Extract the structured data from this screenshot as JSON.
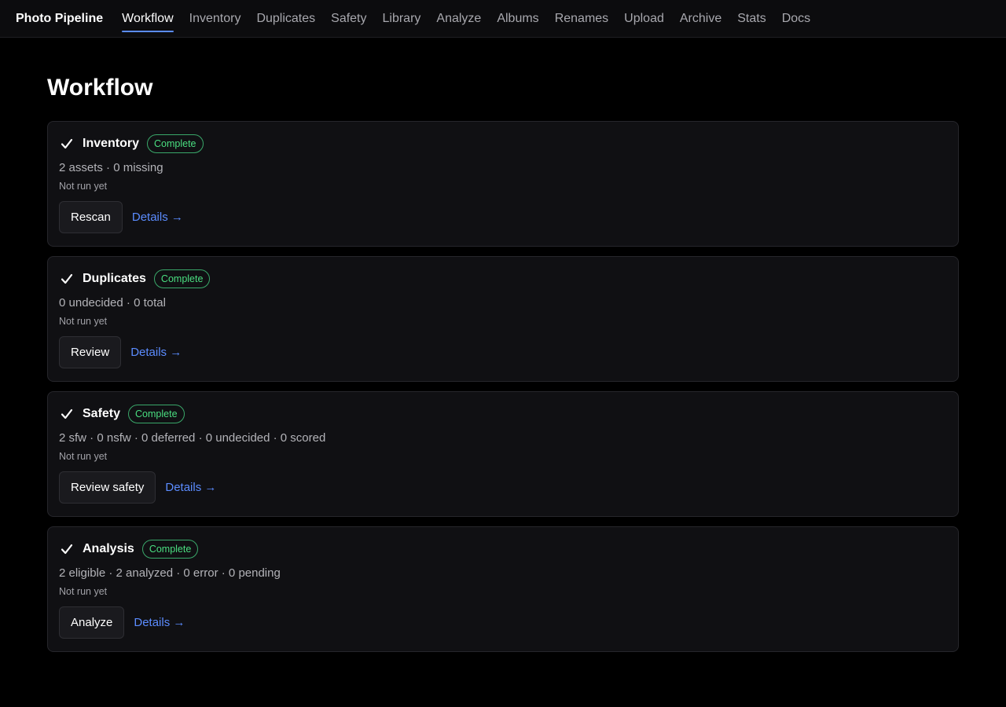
{
  "app": {
    "title": "Photo Pipeline"
  },
  "nav": {
    "items": [
      {
        "label": "Workflow",
        "active": true
      },
      {
        "label": "Inventory"
      },
      {
        "label": "Duplicates"
      },
      {
        "label": "Safety"
      },
      {
        "label": "Library"
      },
      {
        "label": "Analyze"
      },
      {
        "label": "Albums"
      },
      {
        "label": "Renames"
      },
      {
        "label": "Upload"
      },
      {
        "label": "Archive"
      },
      {
        "label": "Stats"
      },
      {
        "label": "Docs"
      }
    ]
  },
  "page": {
    "title": "Workflow"
  },
  "colors": {
    "accent": "#5b8cff",
    "status_complete": "#4ade80",
    "background": "#000000",
    "card": "#101013"
  },
  "steps": [
    {
      "icon": "check-icon",
      "title": "Inventory",
      "status": "Complete",
      "stats": "2 assets · 0 missing",
      "last_run": "Not run yet",
      "action_label": "Rescan",
      "details_label": "Details →"
    },
    {
      "icon": "check-icon",
      "title": "Duplicates",
      "status": "Complete",
      "stats": "0 undecided · 0 total",
      "last_run": "Not run yet",
      "action_label": "Review",
      "details_label": "Details →"
    },
    {
      "icon": "check-icon",
      "title": "Safety",
      "status": "Complete",
      "stats": "2 sfw · 0 nsfw · 0 deferred · 0 undecided · 0 scored",
      "last_run": "Not run yet",
      "action_label": "Review safety",
      "details_label": "Details →"
    },
    {
      "icon": "check-icon",
      "title": "Analysis",
      "status": "Complete",
      "stats": "2 eligible · 2 analyzed · 0 error · 0 pending",
      "last_run": "Not run yet",
      "action_label": "Analyze",
      "details_label": "Details →"
    }
  ]
}
